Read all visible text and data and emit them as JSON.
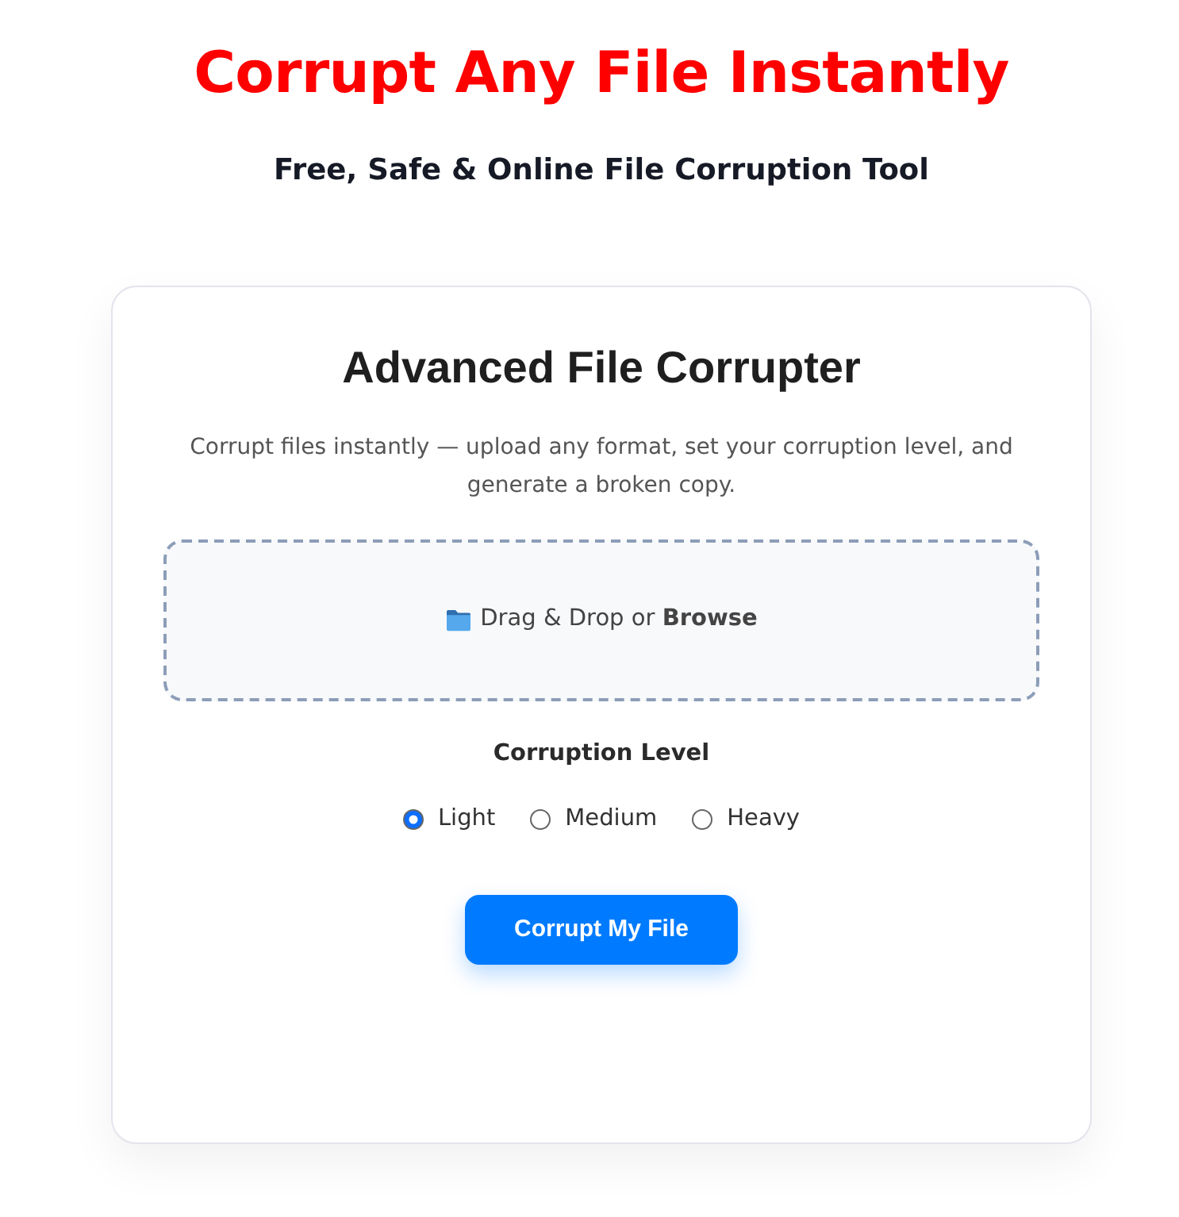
{
  "header": {
    "title": "Corrupt Any File Instantly",
    "subtitle": "Free, Safe & Online File Corruption Tool"
  },
  "card": {
    "title": "Advanced File Corrupter",
    "description": "Corrupt files instantly — upload any format, set your corruption level, and generate a broken copy.",
    "dropzone": {
      "text": "Drag & Drop or **Browse**"
    },
    "level_label": "Corruption Level",
    "levels": [
      {
        "label": "Light",
        "selected": true
      },
      {
        "label": "Medium",
        "selected": false
      },
      {
        "label": "Heavy",
        "selected": false
      }
    ],
    "button": "Corrupt My File"
  }
}
